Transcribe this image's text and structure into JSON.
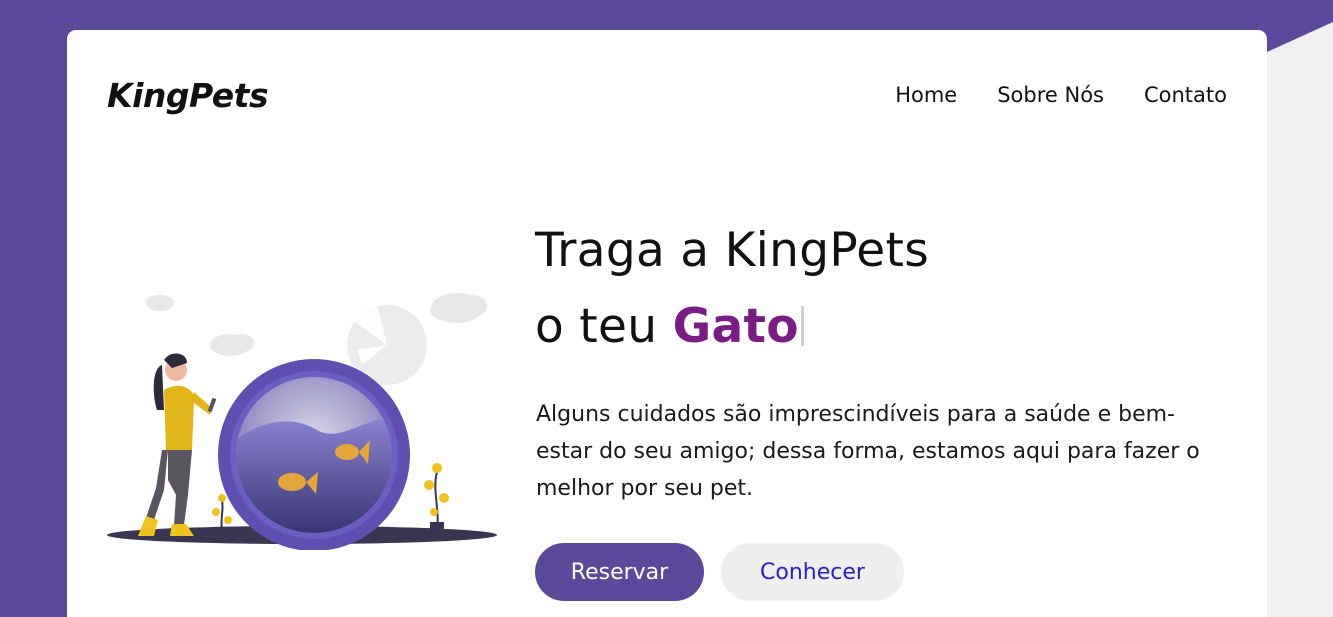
{
  "brand": {
    "name": "KingPets"
  },
  "nav": {
    "items": [
      {
        "label": "Home"
      },
      {
        "label": "Sobre Nós"
      },
      {
        "label": "Contato"
      }
    ]
  },
  "hero": {
    "headline_line1": "Traga a KingPets",
    "headline_line2_prefix": "o teu ",
    "headline_pet": "Gato",
    "description": "Alguns cuidados são imprescindíveis para a saúde e bem-estar do seu amigo; dessa forma, estamos aqui para fazer o melhor por seu pet.",
    "illustration_icon": "woman-with-fishbowl-illustration",
    "primary_button": "Reservar",
    "secondary_button": "Conhecer"
  },
  "colors": {
    "background": "#5b4a9b",
    "accent_pet_text": "#7a1b86",
    "primary_button": "#5b4a9b",
    "secondary_button_bg": "#efefef",
    "secondary_button_text": "#2a1fc8",
    "side_gray": "#f0f0f0"
  }
}
